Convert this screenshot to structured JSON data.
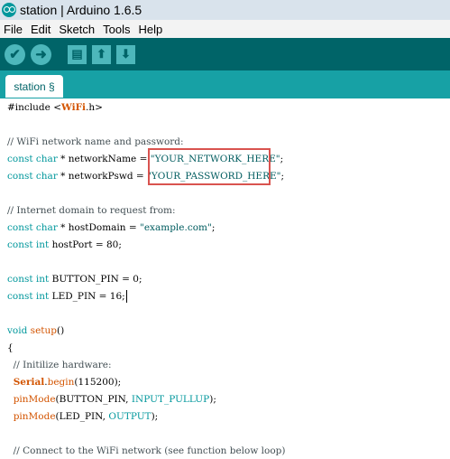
{
  "window": {
    "title": "station | Arduino 1.6.5"
  },
  "menu": [
    "File",
    "Edit",
    "Sketch",
    "Tools",
    "Help"
  ],
  "toolbar": {
    "verify_icon": "✔",
    "upload_icon": "➜",
    "new_icon": "▤",
    "open_icon": "⬆",
    "save_icon": "⬇",
    "accent_color": "#006468"
  },
  "tab": {
    "label": "station §"
  },
  "code": {
    "l1_a": "#include <",
    "l1_b": "WiFi",
    "l1_c": ".h>",
    "l2": "// WiFi network name and password:",
    "l3_kw": "const char",
    "l3_mid": " * networkName = ",
    "l3_str": "\"YOUR_NETWORK_HERE\"",
    "l3_end": ";",
    "l4_kw": "const char",
    "l4_mid": " * networkPswd = ",
    "l4_str": "\"YOUR_PASSWORD_HERE\"",
    "l4_end": ";",
    "l5": "// Internet domain to request from:",
    "l6_kw": "const char",
    "l6_mid": " * hostDomain = ",
    "l6_str": "\"example.com\"",
    "l6_end": ";",
    "l7_kw": "const int",
    "l7_rest": " hostPort = 80;",
    "l8_kw": "const int",
    "l8_rest": " BUTTON_PIN = 0;",
    "l9_kw": "const int",
    "l9_rest": " LED_PIN = 16;",
    "l10_kw": "void",
    "l10_fn": " setup",
    "l10_rest": "()",
    "l11": "{",
    "l12": "  // Initilize hardware:",
    "l13_pre": "  ",
    "l13_obj": "Serial",
    "l13_dot": ".",
    "l13_fn": "begin",
    "l13_rest": "(115200);",
    "l14_pre": "  ",
    "l14_fn": "pinMode",
    "l14_a": "(BUTTON_PIN, ",
    "l14_kw": "INPUT_PULLUP",
    "l14_end": ");",
    "l15_pre": "  ",
    "l15_fn": "pinMode",
    "l15_a": "(LED_PIN, ",
    "l15_kw": "OUTPUT",
    "l15_end": ");",
    "l16": "  // Connect to the WiFi network (see function below loop)"
  }
}
